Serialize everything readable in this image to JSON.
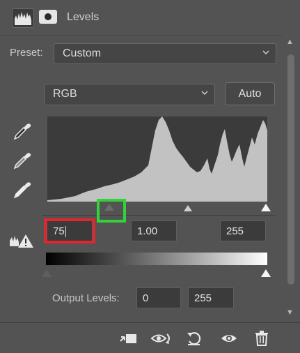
{
  "header": {
    "title": "Levels",
    "tabs": [
      "histogram-icon",
      "mask-icon"
    ]
  },
  "preset": {
    "label": "Preset:",
    "value": "Custom"
  },
  "channel": {
    "value": "RGB"
  },
  "auto_button": {
    "label": "Auto"
  },
  "input_levels": {
    "black": "75",
    "gamma": "1.00",
    "white": "255"
  },
  "output_levels": {
    "label": "Output Levels:",
    "black": "0",
    "white": "255"
  },
  "tools": [
    "black-point-eyedropper-icon",
    "gray-point-eyedropper-icon",
    "white-point-eyedropper-icon",
    "clipping-warning-icon"
  ],
  "footer": {
    "icons": [
      "clip-to-layer-icon",
      "view-previous-state-icon",
      "reset-icon",
      "toggle-visibility-icon",
      "delete-icon"
    ]
  },
  "colors": {
    "panel_bg": "#535353",
    "field_bg": "#3b3b3b",
    "histogram_fill": "#c2c2c2",
    "highlight_red": "#e0262e",
    "highlight_green": "#31d23a"
  }
}
